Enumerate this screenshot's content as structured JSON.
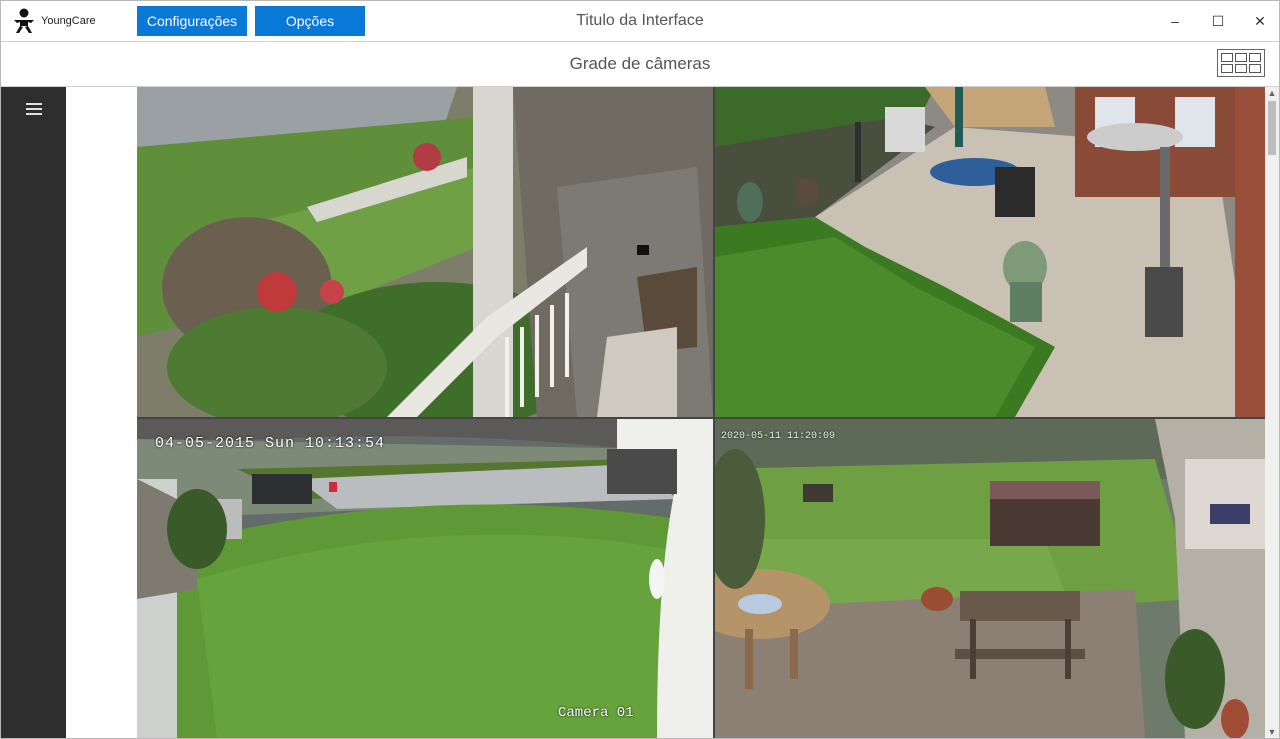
{
  "app": {
    "logo_text": "YoungCare",
    "window_title": "Titulo da Interface"
  },
  "toolbar": {
    "config_label": "Configurações",
    "options_label": "Opções"
  },
  "window_controls": {
    "minimize": "–",
    "maximize": "☐",
    "close": "✕"
  },
  "header": {
    "title": "Grade de câmeras"
  },
  "cameras": [
    {
      "timestamp": "",
      "name": ""
    },
    {
      "timestamp": "",
      "name": ""
    },
    {
      "timestamp": "04-05-2015 Sun 10:13:54",
      "name": "Camera 01"
    },
    {
      "timestamp": "2020-05-11 11:20:09",
      "name": ""
    }
  ],
  "colors": {
    "accent": "#0a78d7",
    "sidebar": "#2e2e2e"
  },
  "icons": [
    "person-logo-icon",
    "hamburger-menu-icon",
    "grid-layout-icon"
  ]
}
